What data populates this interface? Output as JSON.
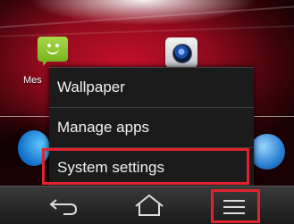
{
  "home_screen": {
    "apps": [
      {
        "label": "Mes",
        "icon": "messaging-icon"
      },
      {
        "icon": "camera-icon"
      },
      {
        "icon": "phone-icon"
      },
      {
        "icon": "browser-globe-icon"
      }
    ]
  },
  "options_menu": {
    "items": [
      {
        "label": "Wallpaper"
      },
      {
        "label": "Manage apps"
      },
      {
        "label": "System settings",
        "highlighted": true
      }
    ]
  },
  "nav_bar": {
    "buttons": [
      {
        "icon": "back-icon"
      },
      {
        "icon": "home-icon"
      },
      {
        "icon": "menu-icon",
        "highlighted": true
      }
    ]
  },
  "colors": {
    "highlight": "#e0232f",
    "menu_background": "#1b1b1b",
    "wallpaper_accent": "#c4102a"
  }
}
